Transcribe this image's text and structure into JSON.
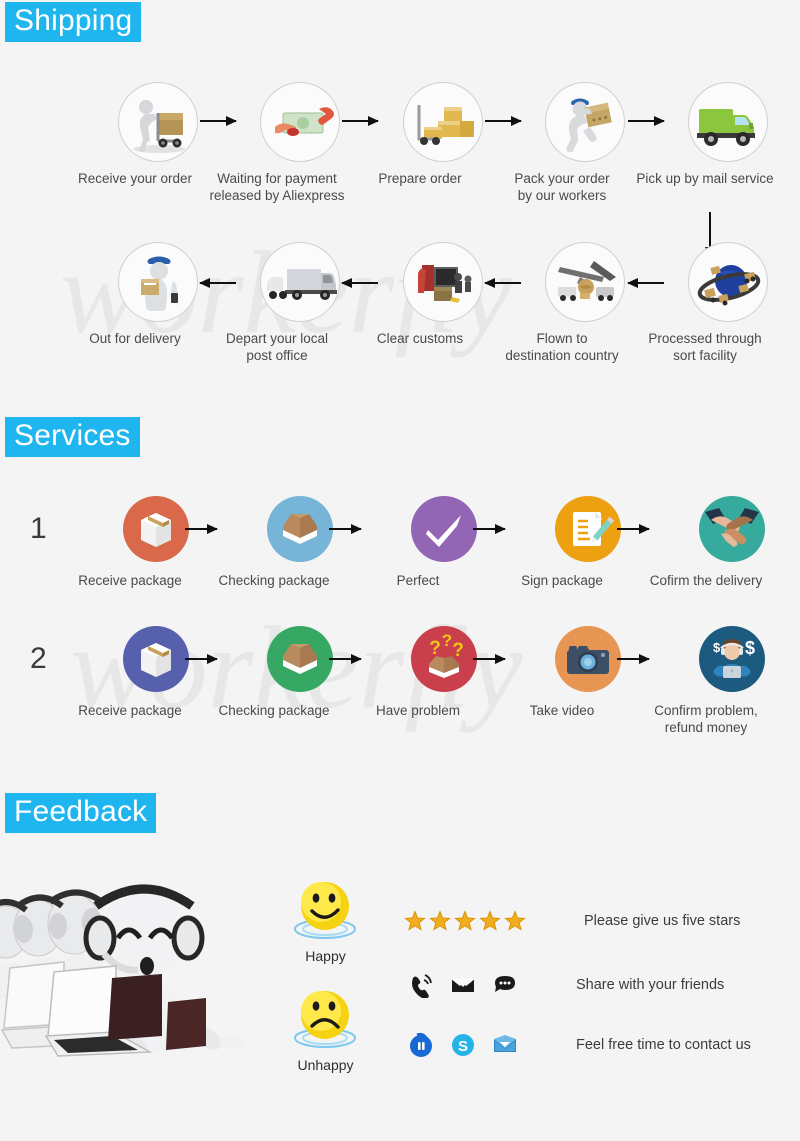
{
  "watermark": {
    "text": "workerfly"
  },
  "sections": {
    "shipping": {
      "title": "Shipping"
    },
    "services": {
      "title": "Services"
    },
    "feedback": {
      "title": "Feedback"
    }
  },
  "shipping": {
    "row1": [
      {
        "label": "Receive your order",
        "icon": "hand-truck-delivery-icon"
      },
      {
        "label": "Waiting for payment\nreleased by Aliexpress",
        "icon": "cash-payment-icon"
      },
      {
        "label": "Prepare  order",
        "icon": "boxes-stack-icon"
      },
      {
        "label": "Pack your order\nby our workers",
        "icon": "worker-carrying-box-icon"
      },
      {
        "label": "Pick up by mail service",
        "icon": "green-truck-icon"
      }
    ],
    "row2": [
      {
        "label": "Out for delivery",
        "icon": "courier-with-parcel-icon"
      },
      {
        "label": "Depart your local\npost office",
        "icon": "cargo-truck-icon"
      },
      {
        "label": "Clear customs",
        "icon": "customs-inspection-icon"
      },
      {
        "label": "Flown to\ndestination country",
        "icon": "airplane-cargo-icon"
      },
      {
        "label": "Processed through\nsort facility",
        "icon": "globe-parcels-icon"
      }
    ]
  },
  "services": {
    "row1": {
      "number": "1",
      "steps": [
        {
          "label": "Receive package",
          "icon": "closed-package-icon",
          "color": "#d9694a"
        },
        {
          "label": "Checking package",
          "icon": "open-box-icon",
          "color": "#76b5d8"
        },
        {
          "label": "Perfect",
          "icon": "checkmark-icon",
          "color": "#9266b5"
        },
        {
          "label": "Sign package",
          "icon": "signed-document-icon",
          "color": "#eda010"
        },
        {
          "label": "Cofirm the delivery",
          "icon": "handshake-icon",
          "color": "#36aa9c"
        }
      ]
    },
    "row2": {
      "number": "2",
      "steps": [
        {
          "label": "Receive package",
          "icon": "closed-package-icon",
          "color": "#5660ad"
        },
        {
          "label": "Checking package",
          "icon": "open-box-icon",
          "color": "#36a864"
        },
        {
          "label": "Have  problem",
          "icon": "question-box-icon",
          "color": "#c9404c"
        },
        {
          "label": "Take video",
          "icon": "camera-icon",
          "color": "#e79552"
        },
        {
          "label": "Confirm problem,\nrefund money",
          "icon": "support-agent-money-icon",
          "color": "#1d5a80"
        }
      ]
    }
  },
  "feedback": {
    "support_image": "customer-service-team-illustration",
    "emotions": [
      {
        "label": "Happy",
        "icon": "happy-smiley-icon"
      },
      {
        "label": "Unhappy",
        "icon": "unhappy-smiley-icon"
      }
    ],
    "rows": [
      {
        "text": "Please give us five stars",
        "icon_set": "five-stars",
        "star_count": 5,
        "star_color": "#f2ad1e"
      },
      {
        "text": "Share with your friends",
        "icon_set": "phone-mail-chat"
      },
      {
        "text": "Feel free time to contact us",
        "icon_set": "messenger-skype-mail"
      }
    ]
  },
  "colors": {
    "header_blue": "#1fb6f0",
    "background": "#f4f4f4",
    "text": "#4a4a4a",
    "arrow": "#101010",
    "watermark": "#e7e7e7"
  }
}
